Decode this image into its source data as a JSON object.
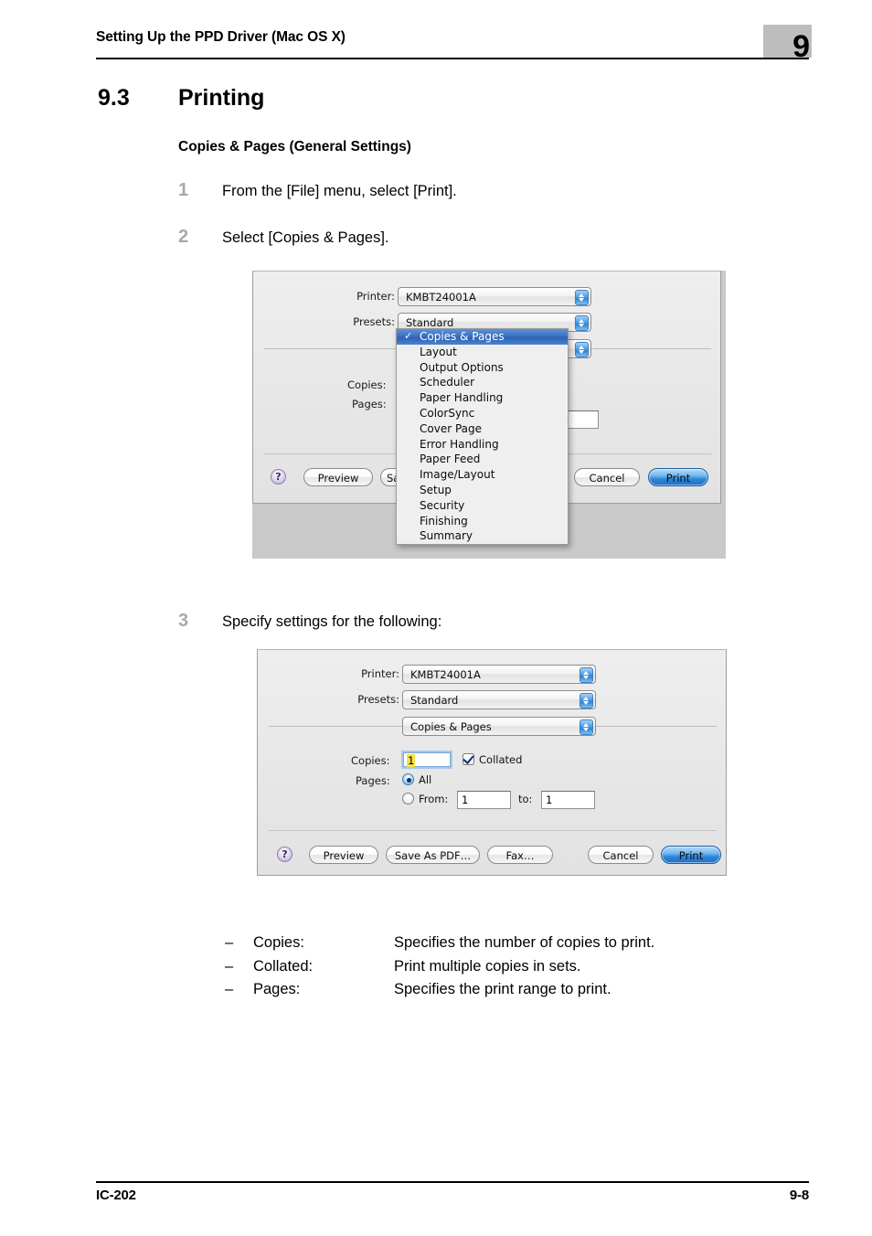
{
  "header": {
    "title": "Setting Up the PPD Driver (Mac OS X)",
    "chapter": "9"
  },
  "footer": {
    "left": "IC-202",
    "right": "9-8"
  },
  "section": {
    "number": "9.3",
    "title": "Printing",
    "subheading": "Copies & Pages (General Settings)"
  },
  "steps": [
    {
      "num": "1",
      "text": "From the [File] menu, select [Print]."
    },
    {
      "num": "2",
      "text": "Select [Copies & Pages]."
    },
    {
      "num": "3",
      "text": "Specify settings for the following:"
    }
  ],
  "definitions": [
    {
      "mark": "–",
      "term": "Copies:",
      "desc": "Specifies the number of copies to print."
    },
    {
      "mark": "–",
      "term": "Collated:",
      "desc": "Print multiple copies in sets."
    },
    {
      "mark": "–",
      "term": "Pages:",
      "desc": "Specifies the print range to print."
    }
  ],
  "dialog1": {
    "printer_label": "Printer:",
    "printer_value": "KMBT24001A",
    "presets_label": "Presets:",
    "presets_value": "Standard",
    "pane_value": "Copies & Pages",
    "copies_label": "Copies:",
    "pages_label": "Pages:",
    "help_glyph": "?",
    "buttons": {
      "preview": "Preview",
      "save_as_pdf": "Sa",
      "cancel": "Cancel",
      "print": "Print"
    },
    "menu_items": [
      "Copies & Pages",
      "Layout",
      "Output Options",
      "Scheduler",
      "Paper Handling",
      "ColorSync",
      "Cover Page",
      "Error Handling",
      "Paper Feed",
      "Image/Layout",
      "Setup",
      "Security",
      "Finishing",
      "Summary"
    ],
    "menu_selected_index": 0
  },
  "dialog2": {
    "printer_label": "Printer:",
    "printer_value": "KMBT24001A",
    "presets_label": "Presets:",
    "presets_value": "Standard",
    "pane_value": "Copies & Pages",
    "copies_label": "Copies:",
    "copies_value": "1",
    "collated_label": "Collated",
    "collated_checked": true,
    "pages_label": "Pages:",
    "pages_all_label": "All",
    "pages_all_selected": true,
    "pages_from_label": "From:",
    "pages_from_value": "1",
    "pages_to_label": "to:",
    "pages_to_value": "1",
    "help_glyph": "?",
    "buttons": {
      "preview": "Preview",
      "save_as_pdf": "Save As PDF…",
      "fax": "Fax…",
      "cancel": "Cancel",
      "print": "Print"
    }
  },
  "colors": {
    "chapter_badge": "#bdbdbd",
    "step_number": "#a8a8a8",
    "menu_highlight": "#3b72c4",
    "primary_button": "#2d86d9",
    "field_selection": "#f7e04a",
    "help_button": "#b6a7d6"
  }
}
